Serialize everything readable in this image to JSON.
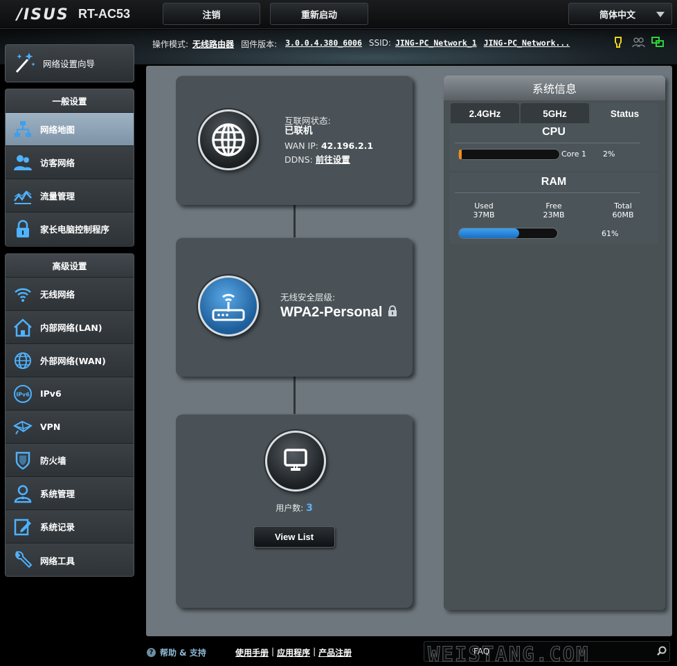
{
  "brand": {
    "logo": "/ISUS",
    "model": "RT-AC53"
  },
  "topbar": {
    "logout": "注销",
    "reboot": "重新启动",
    "language": "简体中文"
  },
  "info": {
    "mode_label": "操作模式:",
    "mode_value": "无线路由器",
    "firmware_label": "固件版本:",
    "firmware_value": "3.0.0.4.380_6006",
    "ssid_label": "SSID:",
    "ssid_1": "JING-PC_Network_1",
    "ssid_2": "JING-PC_Network..."
  },
  "sidebar": {
    "wizard": "网络设置向导",
    "general_title": "一般设置",
    "general_items": [
      {
        "label": "网络地图",
        "icon": "network-map-icon",
        "active": true
      },
      {
        "label": "访客网络",
        "icon": "guest-network-icon"
      },
      {
        "label": "流量管理",
        "icon": "traffic-manager-icon"
      },
      {
        "label": "家长电脑控制程序",
        "icon": "parental-lock-icon"
      }
    ],
    "advanced_title": "高级设置",
    "advanced_items": [
      {
        "label": "无线网络",
        "icon": "wireless-icon"
      },
      {
        "label": "内部网络(LAN)",
        "icon": "home-lan-icon"
      },
      {
        "label": "外部网络(WAN)",
        "icon": "globe-wan-icon"
      },
      {
        "label": "IPv6",
        "icon": "ipv6-icon"
      },
      {
        "label": "VPN",
        "icon": "vpn-icon"
      },
      {
        "label": "防火墙",
        "icon": "firewall-shield-icon"
      },
      {
        "label": "系统管理",
        "icon": "admin-user-icon"
      },
      {
        "label": "系统记录",
        "icon": "system-log-icon"
      },
      {
        "label": "网络工具",
        "icon": "network-tools-icon"
      }
    ]
  },
  "internet": {
    "status_label": "互联网状态:",
    "status_value": "已联机",
    "wan_ip_label": "WAN IP:",
    "wan_ip": "42.196.2.1",
    "ddns_label": "DDNS:",
    "ddns_link": "前往设置"
  },
  "router": {
    "security_label": "无线安全层级:",
    "security_value": "WPA2-Personal"
  },
  "clients": {
    "count_label": "用户数:",
    "count": "3",
    "view_list": "View List"
  },
  "sysinfo": {
    "title": "系统信息",
    "tabs": [
      "2.4GHz",
      "5GHz",
      "Status"
    ],
    "active_tab": "Status",
    "cpu": {
      "title": "CPU",
      "core_label": "Core 1",
      "percent_text": "2%",
      "percent": 2
    },
    "ram": {
      "title": "RAM",
      "used_label": "Used",
      "used": "37MB",
      "free_label": "Free",
      "free": "23MB",
      "total_label": "Total",
      "total": "60MB",
      "percent_text": "61%",
      "percent": 61
    }
  },
  "footer": {
    "help": "帮助 & 支持",
    "manual": "使用手册",
    "apps": "应用程序",
    "register": "产品注册",
    "sep": "|",
    "faq": "FAQ",
    "watermark": "WEISTANG.COM"
  },
  "colors": {
    "accent_blue": "#58b4ff",
    "cpu_bar": "#f28b1a",
    "ram_bar": "#2b8be0"
  }
}
